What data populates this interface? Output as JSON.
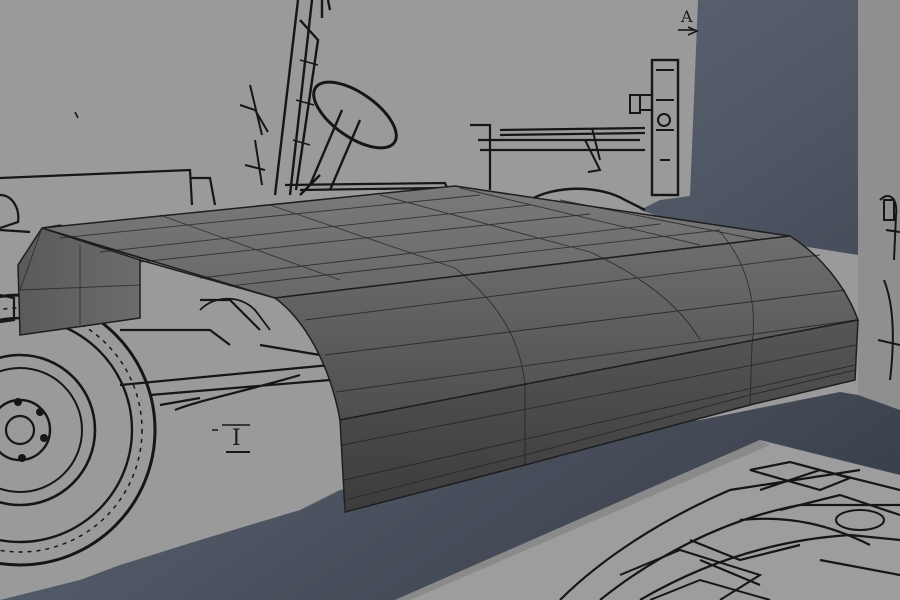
{
  "scene": {
    "blueprint_labels": {
      "top_marker": "A",
      "side_marker": "I"
    }
  },
  "colors": {
    "background_far": "#5b6370",
    "background_near": "#3f4652",
    "blueprint_paper": "#9a9a9a",
    "blueprint_paper_dark": "#8e8e8e",
    "blueprint_lines": "#161616",
    "mesh_top": "#6b6b6b",
    "mesh_side": "#4a4a4a",
    "mesh_edge": "#1e1e1e",
    "mesh_highlight": "#7a7a7a"
  },
  "icons": {
    "arrow_marker": "right-arrow-icon"
  }
}
